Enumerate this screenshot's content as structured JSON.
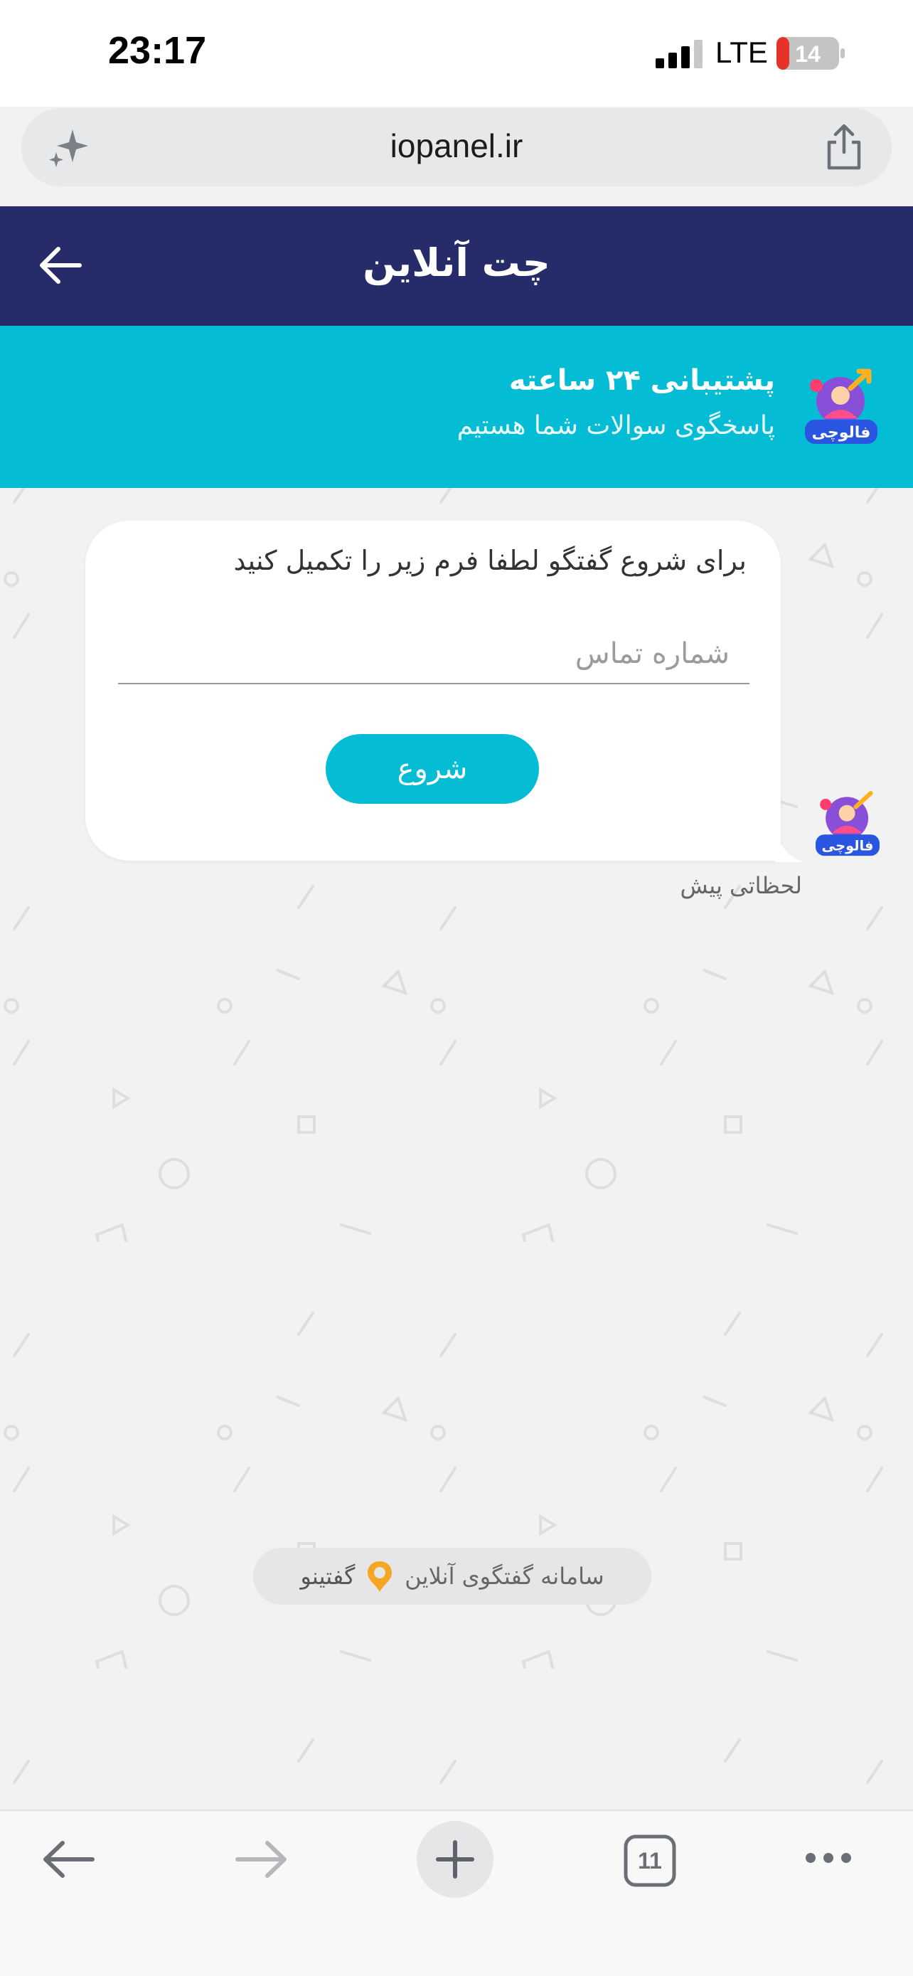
{
  "status_bar": {
    "time": "23:17",
    "network": "LTE",
    "battery": "14"
  },
  "browser": {
    "url": "iopanel.ir"
  },
  "header": {
    "title": "چت آنلاین"
  },
  "banner": {
    "title": "پشتیبانی ۲۴ ساعته",
    "subtitle": "پاسخگوی سوالات شما هستیم",
    "logo_text": "فالوچی"
  },
  "chat": {
    "prompt": "برای شروع گفتگو لطفا فرم زیر را تکمیل کنید",
    "phone_placeholder": "شماره تماس",
    "start_label": "شروع",
    "time": "لحظاتی پیش"
  },
  "footer": {
    "powered_text": "سامانه گفتگوی آنلاین",
    "brand": "گفتینو"
  },
  "toolbar": {
    "tabs_count": "11"
  },
  "colors": {
    "header": "#262b69",
    "accent": "#04bdd5",
    "brand_pin": "#f5a623"
  }
}
